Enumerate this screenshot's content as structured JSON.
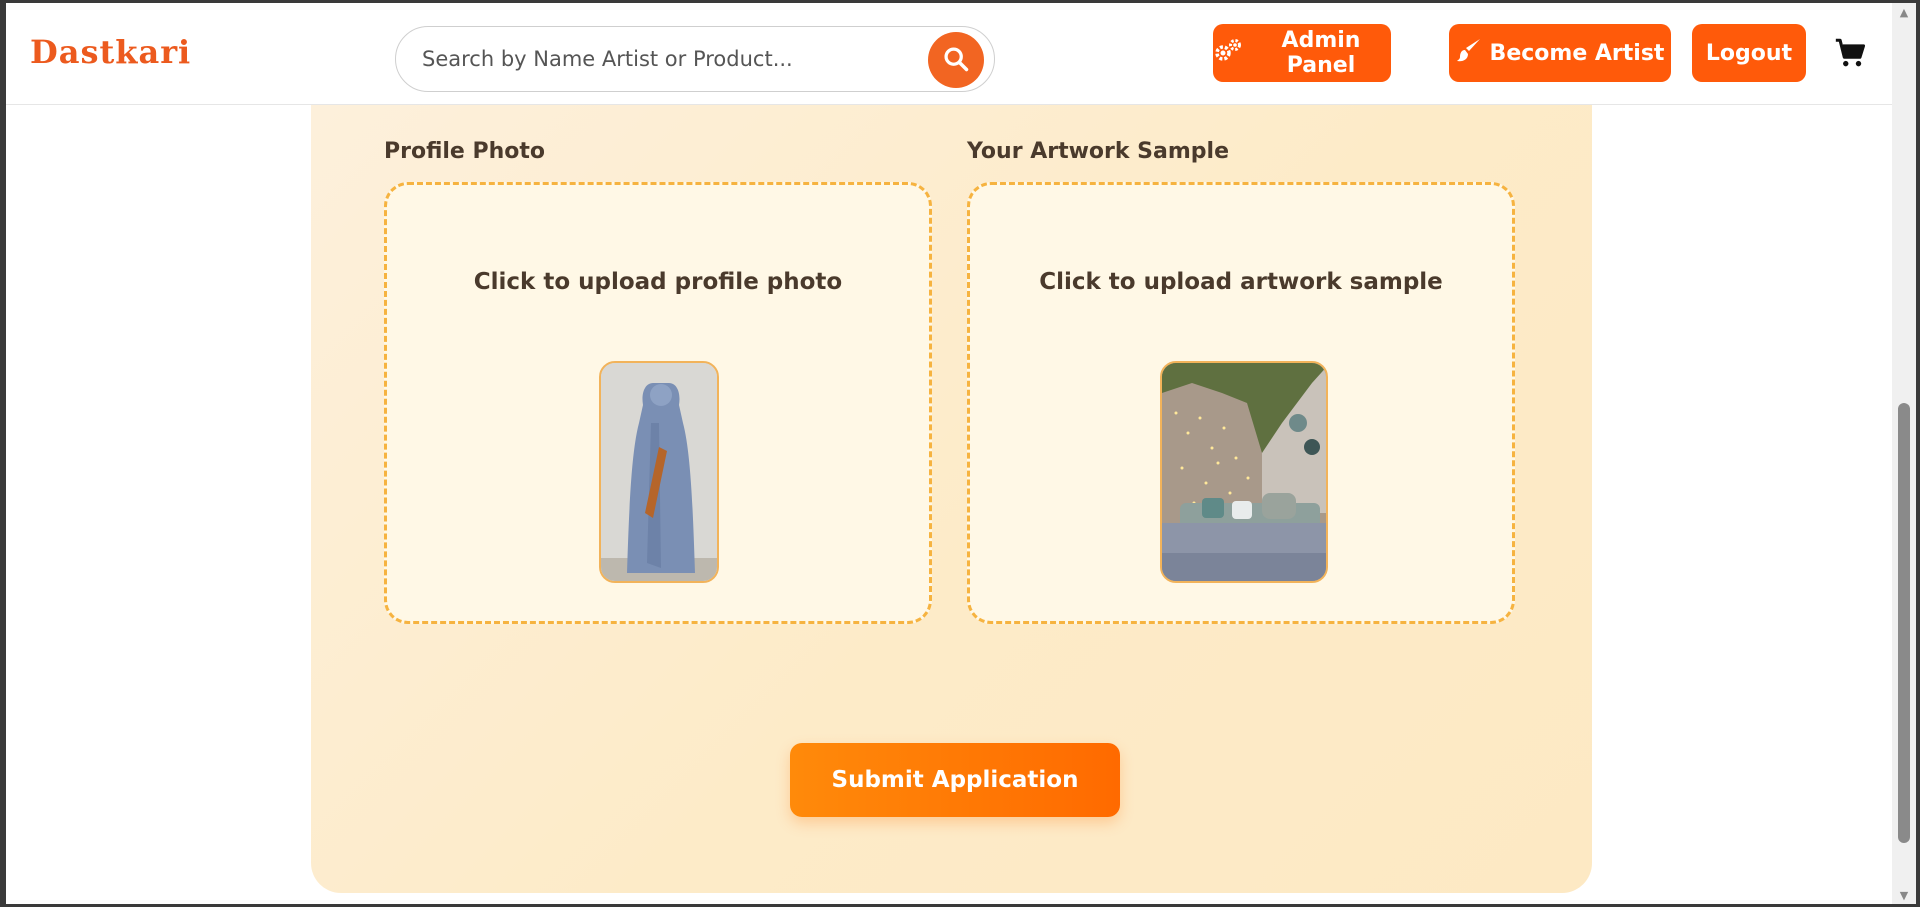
{
  "header": {
    "logo": "Dastkari",
    "search": {
      "placeholder": "Search by Name Artist or Product..."
    },
    "buttons": {
      "admin_panel": "Admin Panel",
      "become_artist": "Become Artist",
      "logout": "Logout"
    }
  },
  "form": {
    "profile_photo": {
      "label": "Profile Photo",
      "upload_text": "Click to upload profile photo"
    },
    "artwork_sample": {
      "label": "Your Artwork Sample",
      "upload_text": "Click to upload artwork sample"
    },
    "submit_label": "Submit Application"
  },
  "colors": {
    "brand": "#ec5a1e",
    "button": "#ff5a0a",
    "card_bg": "#fdebc8",
    "dashed_border": "#f6b340"
  },
  "icons": [
    "search-icon",
    "gears-icon",
    "paintbrush-icon",
    "cart-icon"
  ]
}
